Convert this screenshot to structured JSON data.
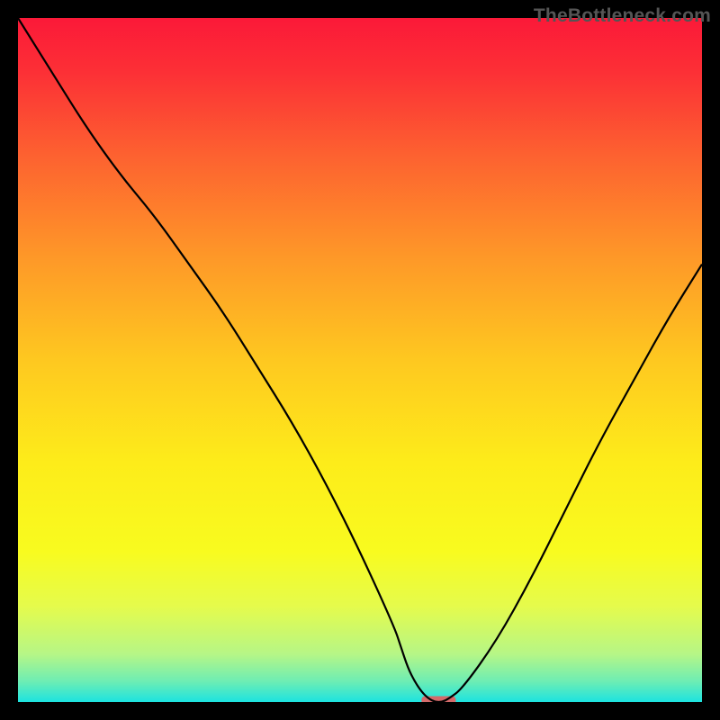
{
  "watermark": "TheBottleneck.com",
  "chart_data": {
    "type": "line",
    "title": "",
    "xlabel": "",
    "ylabel": "",
    "xlim": [
      0,
      100
    ],
    "ylim": [
      0,
      100
    ],
    "x": [
      0,
      5,
      10,
      15,
      20,
      25,
      30,
      35,
      40,
      45,
      50,
      55,
      56,
      57,
      58,
      59,
      60,
      61,
      62,
      63,
      65,
      70,
      75,
      80,
      85,
      90,
      95,
      100
    ],
    "values": [
      100,
      92,
      84,
      77,
      71,
      64,
      57,
      49,
      41,
      32,
      22,
      11,
      8,
      5,
      3,
      1.5,
      0.5,
      0,
      0,
      0.5,
      2,
      9,
      18,
      28,
      38,
      47,
      56,
      64
    ],
    "marker": {
      "x": 61.5,
      "y": 0,
      "w": 5,
      "h": 1.2,
      "color": "#d46a6a"
    },
    "gradient_stops": [
      {
        "offset": 0.0,
        "color": "#fb1938"
      },
      {
        "offset": 0.08,
        "color": "#fc3036"
      },
      {
        "offset": 0.2,
        "color": "#fd6130"
      },
      {
        "offset": 0.35,
        "color": "#fe9828"
      },
      {
        "offset": 0.5,
        "color": "#fec820"
      },
      {
        "offset": 0.65,
        "color": "#fdec1a"
      },
      {
        "offset": 0.78,
        "color": "#f8fb1f"
      },
      {
        "offset": 0.86,
        "color": "#e5fb4c"
      },
      {
        "offset": 0.93,
        "color": "#b6f686"
      },
      {
        "offset": 0.97,
        "color": "#6dedb4"
      },
      {
        "offset": 1.0,
        "color": "#1ce3e0"
      }
    ]
  }
}
